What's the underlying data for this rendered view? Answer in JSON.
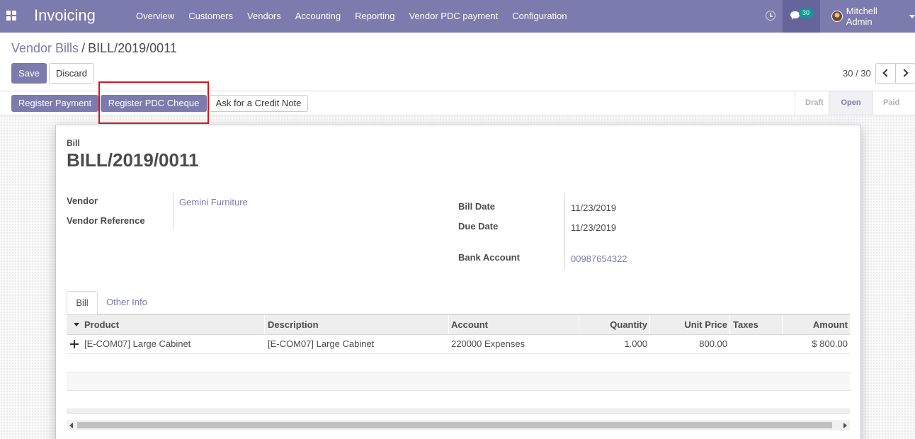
{
  "navbar": {
    "app_name": "Invoicing",
    "menu": [
      "Overview",
      "Customers",
      "Vendors",
      "Accounting",
      "Reporting",
      "Vendor PDC payment",
      "Configuration"
    ],
    "messages_count": "30",
    "user_name": "Mitchell Admin"
  },
  "breadcrumb": {
    "parent": "Vendor Bills",
    "separator": "/",
    "current": "BILL/2019/0011"
  },
  "controls": {
    "save_label": "Save",
    "discard_label": "Discard",
    "pager": "30 / 30"
  },
  "statusbar": {
    "register_payment": "Register Payment",
    "register_pdc_cheque": "Register PDC Cheque",
    "credit_note": "Ask for a Credit Note",
    "stages": [
      "Draft",
      "Open",
      "Paid"
    ],
    "active_stage": "Open"
  },
  "form": {
    "type_label": "Bill",
    "number": "BILL/2019/0011",
    "vendor_label": "Vendor",
    "vendor": "Gemini Furniture",
    "vendor_ref_label": "Vendor Reference",
    "vendor_ref": "",
    "bill_date_label": "Bill Date",
    "bill_date": "11/23/2019",
    "due_date_label": "Due Date",
    "due_date": "11/23/2019",
    "bank_account_label": "Bank Account",
    "bank_account": "00987654322"
  },
  "tabs": [
    "Bill",
    "Other Info"
  ],
  "table": {
    "columns": [
      "Product",
      "Description",
      "Account",
      "Quantity",
      "Unit Price",
      "Taxes",
      "Amount"
    ],
    "rows": [
      {
        "product": "[E-COM07] Large Cabinet",
        "description": "[E-COM07] Large Cabinet",
        "account": "220000 Expenses",
        "quantity": "1.000",
        "unit_price": "800.00",
        "taxes": "",
        "amount": "$ 800.00"
      }
    ]
  },
  "colors": {
    "primary": "#7c7bad",
    "highlight": "#d9161a",
    "badge": "#00a09d"
  }
}
